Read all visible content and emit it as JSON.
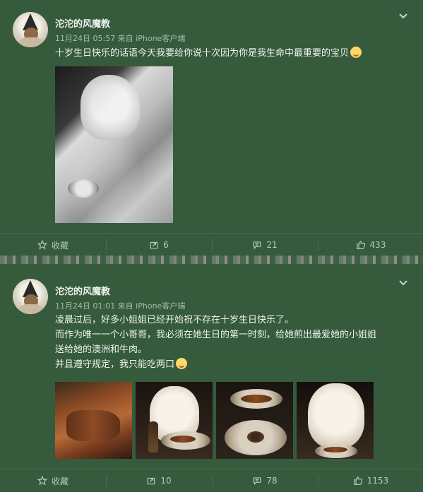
{
  "posts": [
    {
      "author": "沱沱的风魔教",
      "meta": "11月24日 05:57 来自 iPhone客户端",
      "lines": [
        "十岁生日快乐的话语今天我要给你说十次因为你是我生命中最重要的宝贝"
      ],
      "emoji": "smile-emoji",
      "actions": {
        "favorite": "收藏",
        "repost": "6",
        "comment": "21",
        "like": "433"
      }
    },
    {
      "author": "沱沱的风魔教",
      "meta": "11月24日 01:01 来自 iPhone客户端",
      "lines": [
        "凌晨过后，好多小姐姐已经开始祝不存在十岁生日快乐了。",
        "而作为唯一一个小哥哥，我必须在她生日的第一时刻，给她煎出最爱她的小姐姐",
        "送给她的澳洲和牛肉。",
        "并且遵守规定，我只能吃两口"
      ],
      "emoji": "smile-emoji",
      "actions": {
        "favorite": "收藏",
        "repost": "10",
        "comment": "78",
        "like": "1153"
      }
    }
  ],
  "colors": {
    "background": "#345a3a",
    "text": "#eef3ee",
    "meta": "#a9bcaa"
  },
  "icons": {
    "chevron": "chevron-down-icon",
    "favorite": "star-icon",
    "repost": "repost-icon",
    "comment": "comment-icon",
    "like": "thumbs-up-icon"
  }
}
